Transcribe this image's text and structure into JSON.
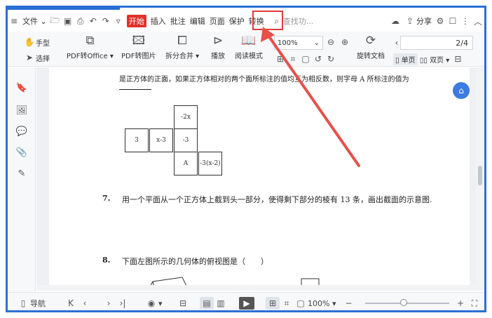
{
  "menu": {
    "file": "文件",
    "open_badge": "开始",
    "insert": "插入",
    "annotate": "批注",
    "edit": "编辑",
    "page": "页面",
    "protect": "保护",
    "convert": "转换",
    "search_placeholder": "查找功...",
    "share": "分享"
  },
  "toolbar": {
    "hand": "手型",
    "select": "选择",
    "pdf_to_office": "PDF转Office",
    "pdf_to_image": "PDF转图片",
    "split_merge": "拆分合并",
    "play": "播放",
    "read_mode": "阅读模式",
    "zoom": "100%",
    "rotate_doc": "旋转文档",
    "single_page": "单页",
    "double_page": "双页",
    "page_indicator": "2/4"
  },
  "document": {
    "header_line": "是正方体的正面，如果正方体相对的两个面所标注的值均互为相反数，则字母 A 所标注的值为",
    "q7_num": "7.",
    "q7_text": "用一个平面从一个正方体上截到头一部分，使得剩下部分的棱有 13 条，画出截面的示意图.",
    "q8_num": "8.",
    "q8_text": "下面左图所示的几何体的俯视图是（　　）",
    "net_cells": {
      "top": "-2x",
      "r1c1": "3",
      "r1c2": "x-3",
      "r1c3": "-3",
      "r2c3": "A",
      "r2c4": "-3(x-2)"
    }
  },
  "statusbar": {
    "nav": "导航",
    "zoom": "100%"
  },
  "colors": {
    "accent": "#2b6fd6",
    "highlight": "#e23b3b",
    "open_badge": "#e0322b"
  }
}
